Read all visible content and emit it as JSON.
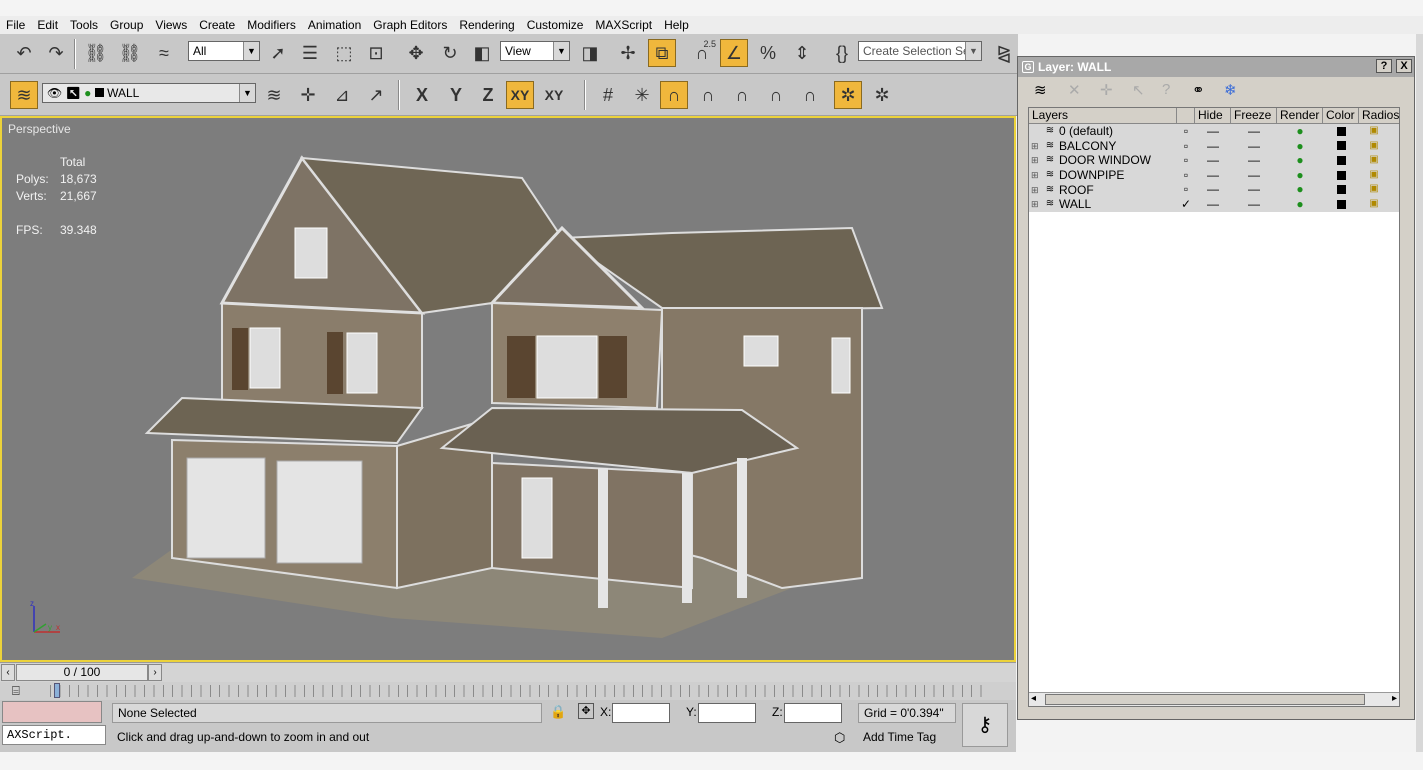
{
  "menu": [
    "File",
    "Edit",
    "Tools",
    "Group",
    "Views",
    "Create",
    "Modifiers",
    "Animation",
    "Graph Editors",
    "Rendering",
    "Customize",
    "MAXScript",
    "Help"
  ],
  "toolbar1": {
    "selection_filter": "All",
    "ref_coord": "View",
    "selection_set_placeholder": "Create Selection Set",
    "snap_label": "2.5"
  },
  "toolbar2": {
    "current_layer": "WALL",
    "axis_x": "X",
    "axis_y": "Y",
    "axis_z": "Z",
    "axis_xy": "XY",
    "axis_xy2": "XY"
  },
  "viewport": {
    "label": "Perspective",
    "stats": {
      "header": "Total",
      "polys_label": "Polys:",
      "polys": "18,673",
      "verts_label": "Verts:",
      "verts": "21,667",
      "fps_label": "FPS:",
      "fps": "39.348"
    }
  },
  "timeline": {
    "frame": "0 / 100",
    "progress": 0.0
  },
  "status": {
    "script": "AXScript.",
    "selection": "None Selected",
    "prompt": "Click and drag up-and-down to zoom in and out",
    "x_label": "X:",
    "y_label": "Y:",
    "z_label": "Z:",
    "grid": "Grid = 0'0.394\"",
    "add_time_tag": "Add Time Tag"
  },
  "layer_dialog": {
    "title": "Layer: WALL",
    "help_btn": "?",
    "close_btn": "X",
    "columns": [
      "Layers",
      "Hide",
      "Freeze",
      "Render",
      "Color",
      "Radios"
    ],
    "layers": [
      {
        "name": "0 (default)",
        "expandable": false,
        "current": false
      },
      {
        "name": "BALCONY",
        "expandable": true,
        "current": false
      },
      {
        "name": "DOOR WINDOW",
        "expandable": true,
        "current": false
      },
      {
        "name": "DOWNPIPE",
        "expandable": true,
        "current": false
      },
      {
        "name": "ROOF",
        "expandable": true,
        "current": false
      },
      {
        "name": "WALL",
        "expandable": true,
        "current": true
      }
    ]
  }
}
